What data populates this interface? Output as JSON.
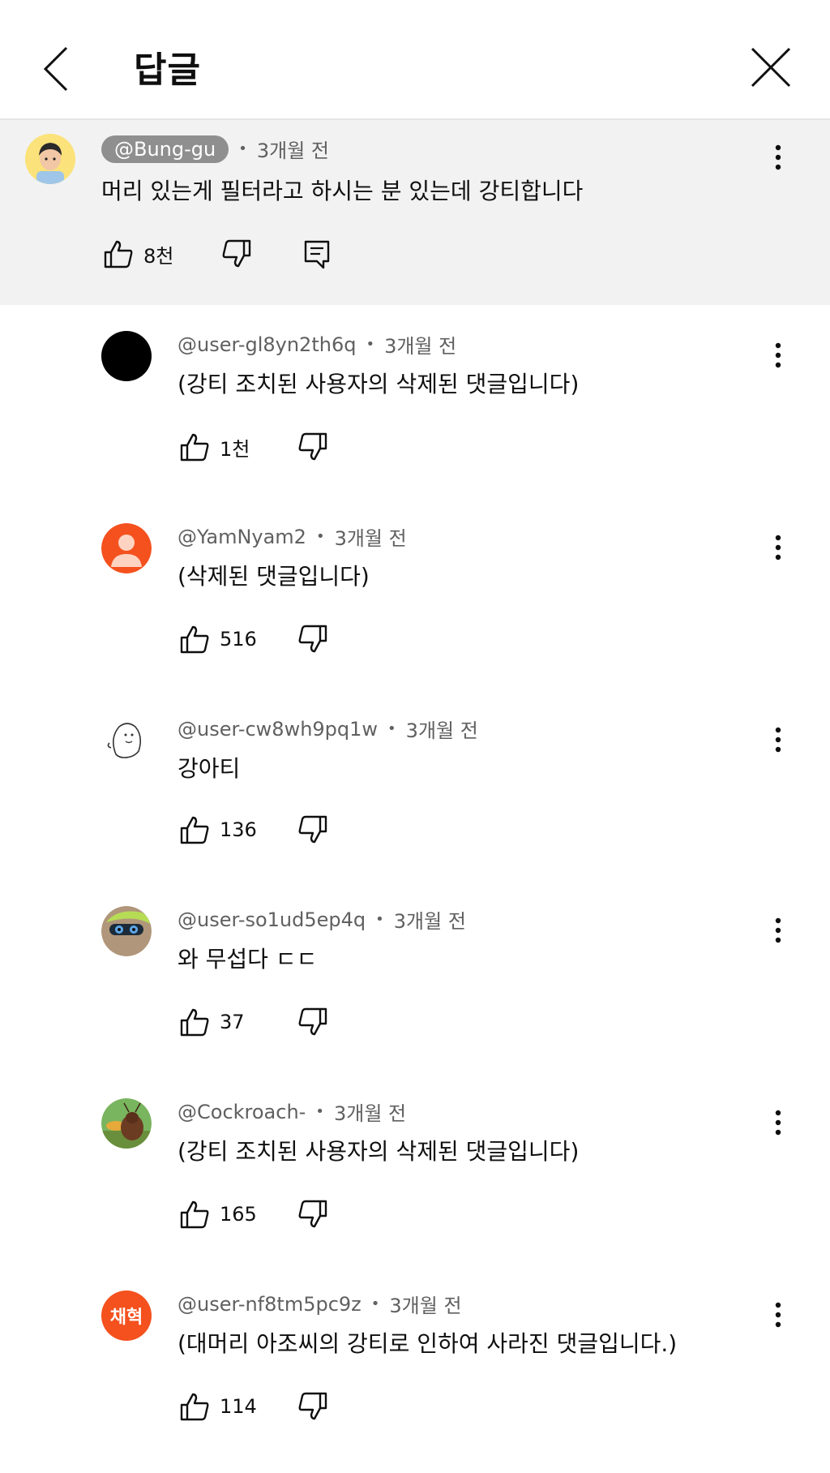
{
  "header": {
    "title": "답글"
  },
  "parent": {
    "author": "@Bung-gu",
    "time": "3개월 전",
    "text": "머리 있는게 필터라고 하시는 분 있는데 강티합니다",
    "likes": "8천"
  },
  "replies": [
    {
      "author": "@user-gl8yn2th6q",
      "time": "3개월 전",
      "text": "(강티 조치된 사용자의 삭제된 댓글입니다)",
      "likes": "1천"
    },
    {
      "author": "@YamNyam2",
      "time": "3개월 전",
      "text": "(삭제된 댓글입니다)",
      "likes": "516"
    },
    {
      "author": "@user-cw8wh9pq1w",
      "time": "3개월 전",
      "text": "강아티",
      "likes": "136"
    },
    {
      "author": "@user-so1ud5ep4q",
      "time": "3개월 전",
      "text": "와 무섭다 ㄷㄷ",
      "likes": "37"
    },
    {
      "author": "@Cockroach-",
      "time": "3개월 전",
      "text": "(강티 조치된 사용자의 삭제된 댓글입니다)",
      "likes": "165"
    },
    {
      "author": "@user-nf8tm5pc9z",
      "time": "3개월 전",
      "text": "(대머리 아조씨의 강티로 인하여 사라진 댓글입니다.)",
      "likes": "114",
      "avatar_text": "채혁"
    }
  ],
  "colors": {
    "avatar_orange": "#f4511e",
    "meta_gray": "#606060",
    "highlight_bg": "#f2f2f2"
  }
}
